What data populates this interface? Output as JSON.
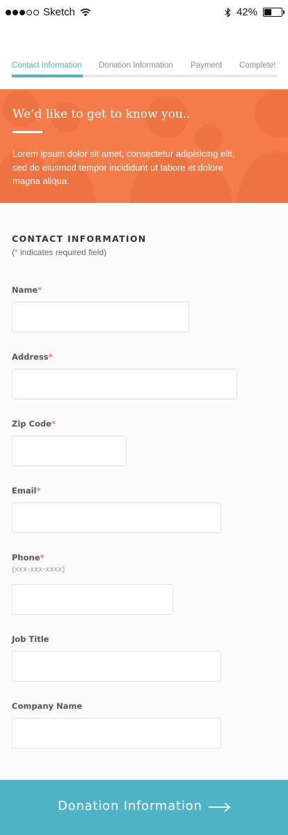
{
  "status_bar": {
    "carrier": "Sketch",
    "battery_percent": "42%",
    "battery_level": 0.42
  },
  "stepper": {
    "steps": [
      {
        "label": "Contact Information"
      },
      {
        "label": "Donation Information"
      },
      {
        "label": "Payment"
      },
      {
        "label": "Complete!"
      }
    ],
    "active_index": 0
  },
  "hero": {
    "title": "We’d like to get to know you..",
    "body": "Lorem ipsum dolor sit amet, consectetur adipisicing elit, sed do eiusmod tempor incididunt ut labore et dolore magna aliqua."
  },
  "form": {
    "section_title": "CONTACT INFORMATION",
    "required_note": {
      "open": "(",
      "asterisk": "*",
      "rest": " indicates required field)"
    },
    "fields": {
      "name": {
        "label": "Name",
        "required": "*",
        "value": ""
      },
      "address": {
        "label": "Address",
        "required": "*",
        "value": ""
      },
      "zip": {
        "label": "Zip Code",
        "required": "*",
        "value": ""
      },
      "email": {
        "label": "Email",
        "required": "*",
        "value": ""
      },
      "phone": {
        "label": "Phone",
        "required": "*",
        "hint": "(xxx-xxx-xxxx)",
        "value": ""
      },
      "job_title": {
        "label": "Job Title",
        "value": ""
      },
      "company": {
        "label": "Company Name",
        "value": ""
      }
    }
  },
  "footer": {
    "next_label": "Donation Information",
    "arrow_icon": "arrow-right-icon"
  },
  "colors": {
    "accent_orange": "#f47c4b",
    "accent_teal": "#4fb3c8"
  }
}
